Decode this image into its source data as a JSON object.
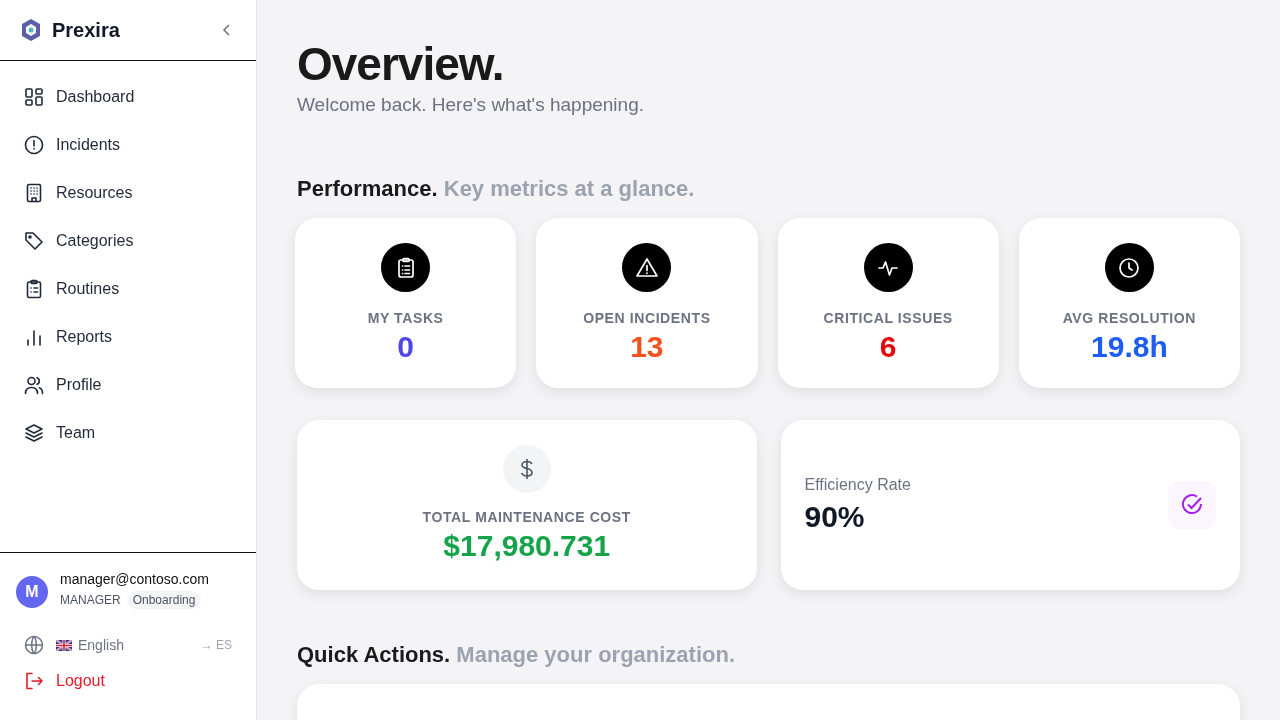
{
  "sidebar": {
    "brand": "Prexira",
    "nav": [
      {
        "label": "Dashboard",
        "kind": "grid"
      },
      {
        "label": "Incidents",
        "kind": "alert"
      },
      {
        "label": "Resources",
        "kind": "building"
      },
      {
        "label": "Categories",
        "kind": "tag"
      },
      {
        "label": "Routines",
        "kind": "clipboard"
      },
      {
        "label": "Reports",
        "kind": "bars"
      },
      {
        "label": "Profile",
        "kind": "users"
      },
      {
        "label": "Team",
        "kind": "layers"
      }
    ],
    "user": {
      "avatar": "M",
      "email": "manager@contoso.com",
      "role": "MANAGER",
      "badge": "Onboarding"
    },
    "language": {
      "label": "English",
      "switch": "→ ES"
    },
    "logout": "Logout"
  },
  "header": {
    "title": "Overview.",
    "subtitle": "Welcome back. Here's what's happening."
  },
  "performance": {
    "title": "Performance.",
    "subtitle": "Key metrics at a glance.",
    "metrics": [
      {
        "label": "MY TASKS",
        "value": "0",
        "color": "#4f46e5",
        "kind": "clipboard"
      },
      {
        "label": "OPEN INCIDENTS",
        "value": "13",
        "color": "#f4511e",
        "kind": "warning"
      },
      {
        "label": "CRITICAL ISSUES",
        "value": "6",
        "color": "#e5080f",
        "kind": "pulse"
      },
      {
        "label": "AVG RESOLUTION",
        "value": "19.8h",
        "color": "#1d5cf5",
        "kind": "clock"
      }
    ],
    "cost": {
      "label": "TOTAL MAINTENANCE COST",
      "value": "$17,980.731"
    },
    "efficiency": {
      "label": "Efficiency Rate",
      "value": "90%"
    }
  },
  "quick_actions": {
    "title": "Quick Actions.",
    "subtitle": "Manage your organization."
  }
}
